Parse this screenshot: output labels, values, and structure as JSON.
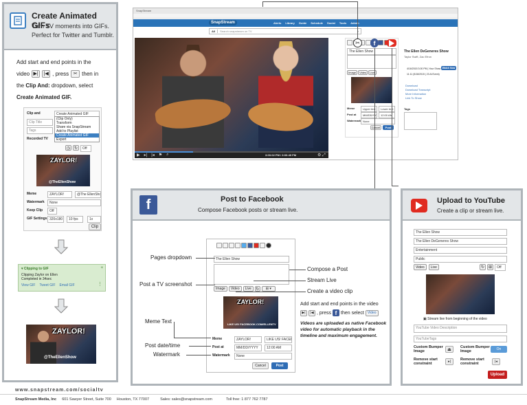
{
  "gifs": {
    "title": "Create Animated GIFs",
    "subtitle_line1": "Turn TV moments into GIFs.",
    "subtitle_line2": "Perfect for Twitter and Tumblr.",
    "instr_1": "Add start and end points in the",
    "instr_2a": "video",
    "instr_2b": ", press",
    "instr_2c": "then in",
    "instr_3a": "the",
    "instr_3b": "Clip And:",
    "instr_3c": "dropdown, select",
    "instr_4": "Create Animated GIF.",
    "form": {
      "clip_and_label": "Clip and",
      "clip_and_value": "Create Animated GIF",
      "clip_title_placeholder": "Clip Title",
      "tags_placeholder": "Tags",
      "recorded_tv": "Recorded TV",
      "dropdown_options": [
        "(Clip Only)",
        "Transform",
        "Share via SnapStream",
        "Add to Playlist",
        "Create Animated GIF",
        "Export"
      ],
      "thumb_caption": "@TheEllenShow",
      "meme_label": "Meme",
      "meme_value1": "ZAYLOR!",
      "meme_value2": "@The EllenShow",
      "watermark_label": "Watermark",
      "watermark_value": "None",
      "keep_clip_label": "Keep Clip",
      "keep_clip_value": "Off",
      "gif_settings_label": "GIF Settings",
      "gif_size": "320x180",
      "gif_fps": "10 fps",
      "gif_speed": "1x",
      "clip_button": "Clip"
    },
    "toast": {
      "title": "Clipping to GIF",
      "line1": "Clipping Zaylor on Ellen",
      "line2": "Completed in 34sec",
      "view": "View GIF",
      "tweet": "Tweet GIF",
      "email": "Email GIF"
    },
    "result_meme_top": "ZAYLOR!",
    "result_meme_bottom": "@TheEllenShow"
  },
  "main_app": {
    "browser_tab": "SnapStream",
    "logo": "SnapStream",
    "nav": [
      "Alerts",
      "Library",
      "Guide",
      "Schedule",
      "Social",
      "Tools",
      "Admin"
    ],
    "search_scope": "All",
    "search_placeholder": "Search snapstream on TV",
    "timecode": "3:00:02 PM / 3:00:49 PM",
    "show_title": "The Ellen DeGeneres Show",
    "show_sub": "Taylor Swift, Zac Efron",
    "airing1": "4/16/2015 3:00 PM | Your Show",
    "airing_btn": "Watch Now",
    "airing2": "11:11 (5/18/2015 | 23 Al Event)",
    "links": [
      "Download",
      "Download Transcript",
      "More Information",
      "Link To Show"
    ],
    "tags_label": "Tags",
    "side_dropdown": "The Ellen Show",
    "meme_label": "Meme",
    "meme_v1": "Upper text",
    "meme_v2": "Lower text",
    "post_label": "Post at",
    "post_v1": "MM/DD/YYYY",
    "post_v2": "12:00 AM",
    "wm_label": "Watermark",
    "wm_value": "None",
    "cancel": "Cancel",
    "post": "Post"
  },
  "facebook": {
    "title": "Post to Facebook",
    "subtitle": "Compose Facebook posts or stream live.",
    "pages_dropdown_label": "Pages dropdown",
    "pages_value": "The Ellen Show",
    "compose_label": "Compose a Post",
    "stream_label": "Stream Live",
    "screenshot_label": "Post a TV screenshot",
    "video_clip_label": "Create a video clip",
    "btn_image": "Image",
    "btn_video": "Video",
    "btn_live": "Live",
    "instr1": "Add start and end points in the video",
    "instr2a": ", press",
    "instr2b": "then select",
    "instr2c": "Video",
    "note": "Videos are uploaded as native Facebook video for automatic playback in the timeline and maximum engagement.",
    "meme_text_label": "Meme Text",
    "post_date_label": "Post date/time",
    "watermark_label": "Watermark",
    "meme_top": "ZAYLOR!",
    "meme_bottom": "LIKE US! FACEBOOK.COM/ELLENTV",
    "meme_l": "Meme",
    "meme_v1": "ZAYLOR!",
    "meme_v2": "LIKE US! FACEB",
    "post_l": "Post at",
    "post_v1": "MM/DD/YYYY",
    "post_v2": "12:00 AM",
    "wm_l": "Watermark",
    "wm_v": "None",
    "cancel": "Cancel",
    "post": "Post"
  },
  "youtube": {
    "title": "Upload to YouTube",
    "subtitle": "Create a clip or stream live.",
    "dd1": "The Ellen Show",
    "title_field": "The Ellen DeGeneres Show",
    "dd_category": "Entertainment",
    "dd_privacy": "Public",
    "btn_video": "Video",
    "btn_live": "Live",
    "off": "Off",
    "stream_note": "Stream live from beginning of the video",
    "desc_placeholder": "YouTube Video Description",
    "tags_placeholder": "YouTubeTags",
    "bumper1": "Custom Bumper Image",
    "bumper2": "Custom Bumper Image",
    "bumper_on": "On",
    "remove1": "Remove start constraint",
    "remove2": "Remove start constraint",
    "upload": "Upload"
  },
  "footer": {
    "url": "www.snapstream.com/socialtv",
    "company": "SnapStream Media, Inc",
    "address": "601 Sawyer Street, Suite 700",
    "city": "Houston, TX 77007",
    "sales": "Sales: sales@snapstream.com",
    "phone": "Toll free: 1 877 762 7787"
  },
  "colors": {
    "facebook": "#3b5998",
    "youtube": "#e02b20",
    "panel_border": "#aeb4b9",
    "accent_blue": "#2f6db5",
    "toast_green": "#d9ecd0"
  }
}
